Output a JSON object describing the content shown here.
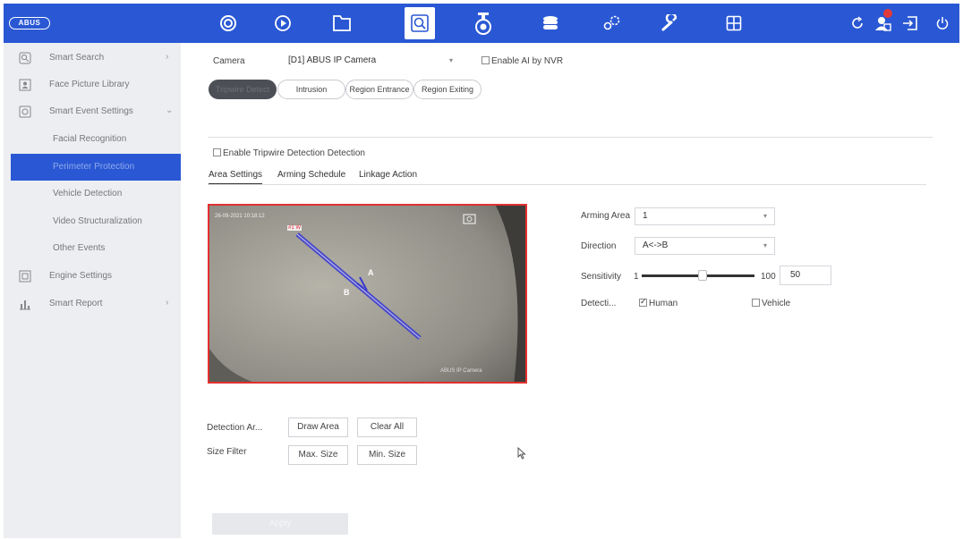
{
  "brand": {
    "logo_text": "ABUS"
  },
  "topnav": {
    "icons": [
      "live-view-icon",
      "playback-icon",
      "files-icon",
      "smart-search-icon",
      "camera-icon",
      "storage-icon",
      "configuration-icon",
      "maintenance-icon",
      "layout-icon"
    ],
    "active": "smart-search-icon",
    "right_icons": [
      "refresh-icon",
      "alarm-user-icon",
      "logout-icon",
      "power-icon"
    ],
    "accent_color": "#2a58d4",
    "alert_color": "#e23a3a"
  },
  "sidebar": {
    "smart_search": "Smart Search",
    "face_picture_library": "Face Picture Library",
    "smart_event_settings": "Smart Event Settings",
    "facial_recognition": "Facial Recognition",
    "perimeter_protection": "Perimeter Protection",
    "vehicle_detection": "Vehicle Detection",
    "video_structuralization": "Video Structuralization",
    "other_events": "Other Events",
    "engine_settings": "Engine Settings",
    "smart_report": "Smart Report"
  },
  "camera": {
    "label": "Camera",
    "value": "[D1] ABUS IP Camera",
    "enable_ai_label": "Enable AI by NVR"
  },
  "mode_tabs": {
    "tripwire": "Tripwire Detect",
    "intrusion": "Intrusion",
    "region_entrance": "Region Entrance",
    "region_exiting": "Region Exiting"
  },
  "enable_detection_label": "Enable Tripwire Detection Detection",
  "sub_tabs": {
    "area_settings": "Area Settings",
    "arming_schedule": "Arming Schedule",
    "linkage_action": "Linkage Action"
  },
  "video": {
    "timestamp": "26-09-2021 10:18:12",
    "camera_label": "ABUS IP Camera",
    "line_label": "#1 W",
    "side_a": "A",
    "side_b": "B",
    "line_color": "#3a3ad0",
    "border_color": "#e23030"
  },
  "settings": {
    "arming_area_label": "Arming Area",
    "arming_area_value": "1",
    "direction_label": "Direction",
    "direction_value": "A<->B",
    "sensitivity_label": "Sensitivity",
    "sensitivity_min": "1",
    "sensitivity_max": "100",
    "sensitivity_value": "50",
    "detection_label": "Detecti...",
    "human_label": "Human",
    "human_checked": true,
    "vehicle_label": "Vehicle",
    "vehicle_checked": false
  },
  "area_controls": {
    "detection_area_label": "Detection Ar...",
    "draw_area": "Draw Area",
    "clear_all": "Clear All",
    "size_filter_label": "Size Filter",
    "max_size": "Max. Size",
    "min_size": "Min. Size"
  },
  "apply_label": "Apply"
}
